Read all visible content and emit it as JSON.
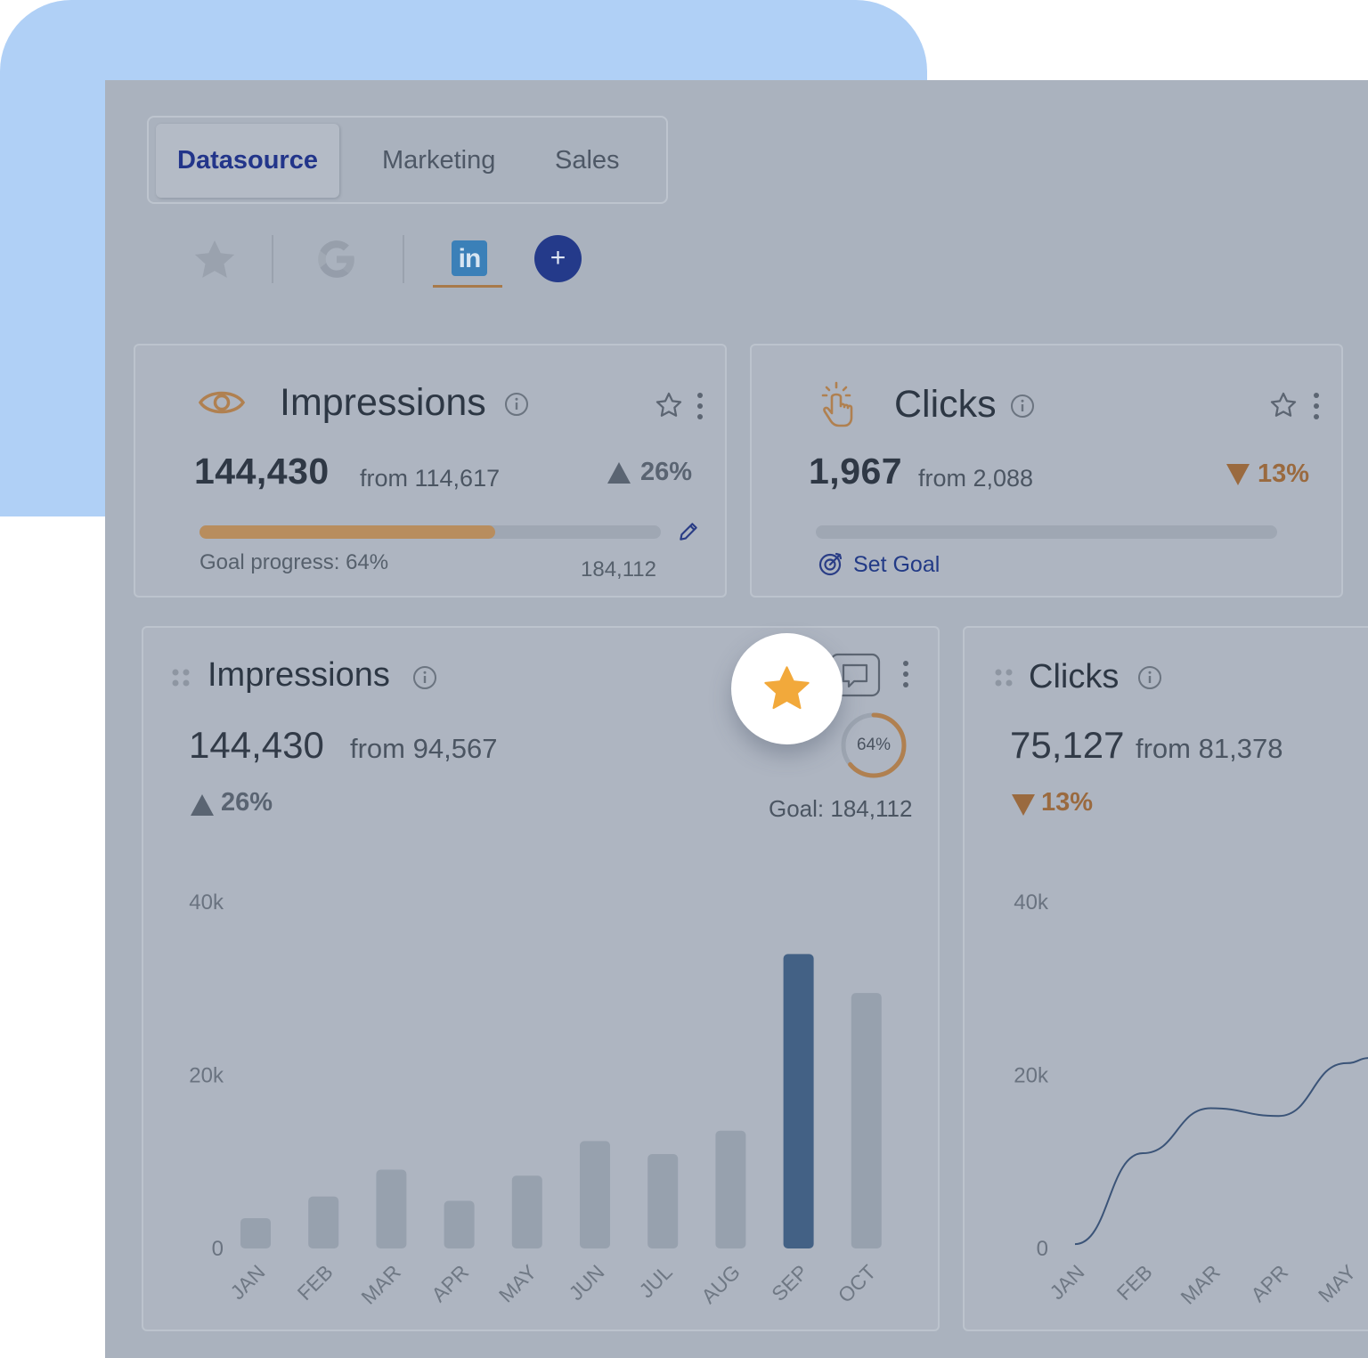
{
  "tabs": [
    {
      "label": "Datasource",
      "active": true
    },
    {
      "label": "Marketing",
      "active": false
    },
    {
      "label": "Sales",
      "active": false
    }
  ],
  "sources": {
    "icons": [
      "star-icon",
      "google-icon",
      "linkedin-icon",
      "add-icon"
    ],
    "linkedin_label": "in",
    "add_label": "+",
    "selected": "linkedin"
  },
  "kpi_impressions": {
    "title": "Impressions",
    "value": "144,430",
    "from": "from 114,617",
    "delta": "26%",
    "direction": "up",
    "goal_progress_label": "Goal progress: 64%",
    "goal_progress": 0.64,
    "goal_value": "184,112"
  },
  "kpi_clicks": {
    "title": "Clicks",
    "value": "1,967",
    "from": "from 2,088",
    "delta": "13%",
    "direction": "down",
    "set_goal_label": "Set Goal"
  },
  "chart_impressions": {
    "title": "Impressions",
    "value": "144,430",
    "from": "from 94,567",
    "delta": "26%",
    "goal_ring": "64%",
    "goal_ring_fraction": 0.64,
    "goal_label": "Goal: 184,112"
  },
  "chart_clicks": {
    "title": "Clicks",
    "value": "75,127",
    "from": "from 81,378",
    "delta": "13%"
  },
  "colors": {
    "accent_orange": "#b88d5e",
    "brand_navy": "#243a8a",
    "highlight_bar": "#436185",
    "star_gold": "#f2a93b"
  },
  "chart_data": [
    {
      "type": "bar",
      "title": "Impressions",
      "categories": [
        "JAN",
        "FEB",
        "MAR",
        "APR",
        "MAY",
        "JUN",
        "JUL",
        "AUG",
        "SEP",
        "OCT"
      ],
      "values": [
        3500,
        6000,
        9100,
        5500,
        8400,
        12400,
        10900,
        13600,
        34000,
        29500
      ],
      "y_ticks": [
        "0",
        "20k",
        "40k"
      ],
      "ylim": [
        0,
        40000
      ],
      "highlighted": "SEP",
      "grid": false
    },
    {
      "type": "line",
      "title": "Clicks",
      "categories": [
        "JAN",
        "FEB",
        "MAR",
        "APR",
        "MAY"
      ],
      "x": [
        0,
        1,
        2,
        3,
        4,
        4.35
      ],
      "values": [
        500,
        11000,
        16200,
        15300,
        21400,
        22000
      ],
      "y_ticks": [
        "0",
        "20k",
        "40k"
      ],
      "ylim": [
        0,
        40000
      ],
      "grid": false
    }
  ]
}
